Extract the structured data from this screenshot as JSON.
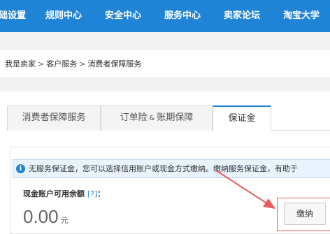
{
  "topnav": {
    "items": [
      "础设置",
      "规则中心",
      "安全中心",
      "服务中心",
      "卖家论坛",
      "淘宝大学"
    ]
  },
  "breadcrumb": {
    "items": [
      "我是卖家",
      "客户服务",
      "消费者保障服务"
    ],
    "separator": ">"
  },
  "tabs": {
    "consumer": "消费者保障服务",
    "order_left": "订单险",
    "order_amp": "&",
    "order_right": "账期保障",
    "deposit": "保证金"
  },
  "notice": {
    "icon": "info-icon",
    "icon_glyph": "i",
    "text": "无服务保证金，您可以选择信用账户或现金方式缴纳。缴纳服务保证金，有助于"
  },
  "balance": {
    "label": "现金账户可用余额",
    "help": "[?]",
    "colon": "：",
    "amount": "0.00",
    "unit": "元"
  },
  "pay_button": "缴纳",
  "colors": {
    "nav_blue": "#1f83d6",
    "highlight_red": "#eb5a5a"
  }
}
